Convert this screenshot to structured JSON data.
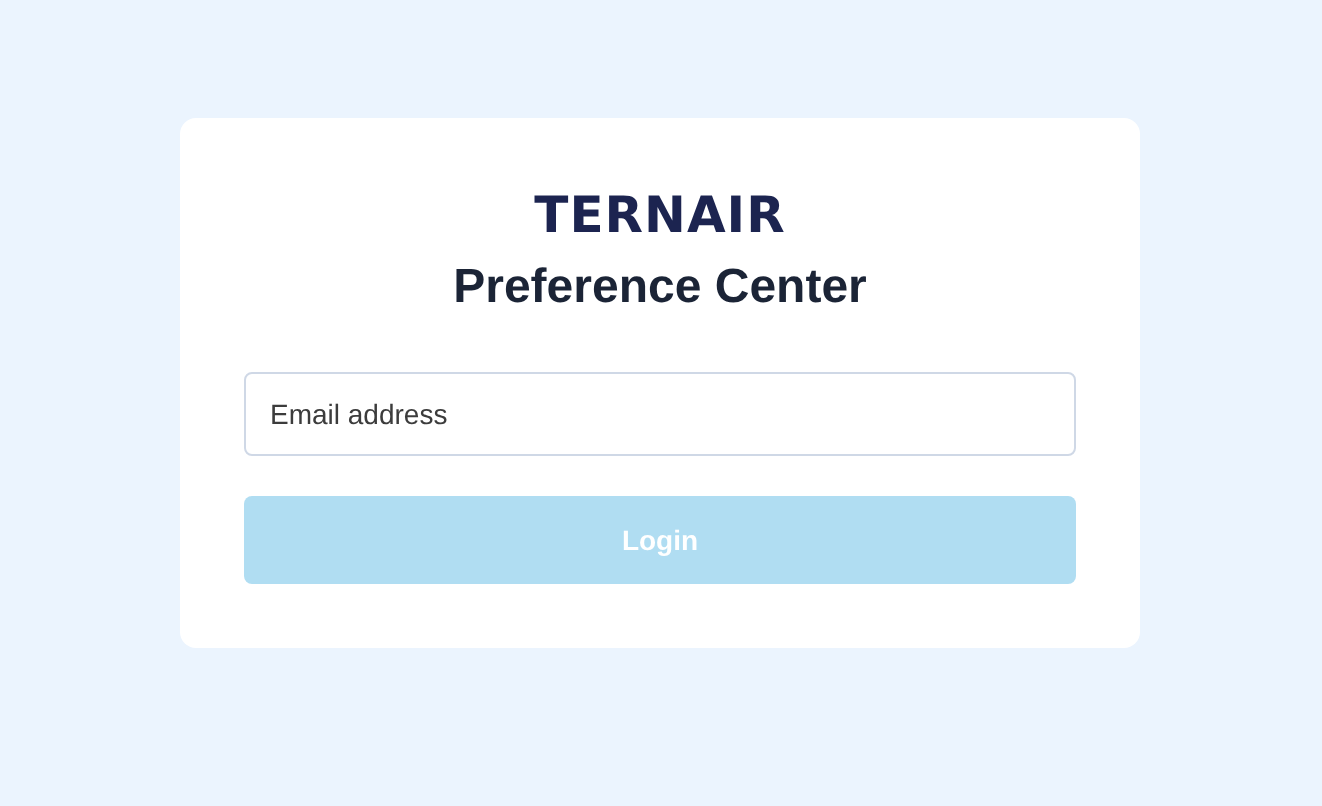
{
  "logo": "TERNAIR",
  "title": "Preference Center",
  "email_field": {
    "placeholder": "Email address"
  },
  "login_button": {
    "label": "Login",
    "disabled": true
  }
}
